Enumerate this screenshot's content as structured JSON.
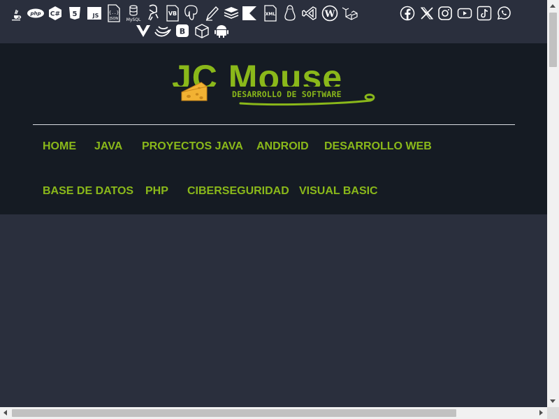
{
  "tech_icons": [
    {
      "name": "java-icon"
    },
    {
      "name": "php-icon",
      "text": "php"
    },
    {
      "name": "csharp-icon",
      "text": "C#"
    },
    {
      "name": "html5-icon",
      "text": "5"
    },
    {
      "name": "javascript-icon",
      "text": "JS"
    },
    {
      "name": "json-icon",
      "text": "JSON"
    },
    {
      "name": "mysql-icon",
      "text": "MySQL"
    },
    {
      "name": "python-icon"
    },
    {
      "name": "visual-basic-icon",
      "text": "VB"
    },
    {
      "name": "postgresql-icon"
    },
    {
      "name": "pencil-icon"
    },
    {
      "name": "layers-icon"
    },
    {
      "name": "kotlin-icon"
    },
    {
      "name": "xml-icon",
      "text": "XML"
    },
    {
      "name": "linux-icon"
    },
    {
      "name": "vscode-icon"
    },
    {
      "name": "wordpress-icon"
    },
    {
      "name": "laravel-icon"
    },
    {
      "name": "vue-icon"
    },
    {
      "name": "nginx-icon"
    },
    {
      "name": "bootstrap-icon",
      "text": "B"
    },
    {
      "name": "box-icon"
    },
    {
      "name": "android-icon"
    }
  ],
  "social_icons": [
    {
      "name": "facebook-icon"
    },
    {
      "name": "x-icon"
    },
    {
      "name": "instagram-icon"
    },
    {
      "name": "youtube-icon"
    },
    {
      "name": "tiktok-icon"
    },
    {
      "name": "whatsapp-icon"
    }
  ],
  "logo": {
    "title": "JC Mouse",
    "subtitle": "DESARROLLO DE SOFTWARE"
  },
  "nav": {
    "items": [
      {
        "label": "HOME"
      },
      {
        "label": "JAVA"
      },
      {
        "label": "PROYECTOS JAVA"
      },
      {
        "label": "ANDROID"
      },
      {
        "label": "DESARROLLO WEB"
      },
      {
        "label": "BASE DE DATOS"
      },
      {
        "label": "PHP"
      },
      {
        "label": "CIBERSEGURIDAD"
      },
      {
        "label": "VISUAL BASIC"
      }
    ]
  },
  "colors": {
    "accent": "#8ab81a",
    "header_bg": "#151b23",
    "page_bg": "#2a2f3d"
  }
}
